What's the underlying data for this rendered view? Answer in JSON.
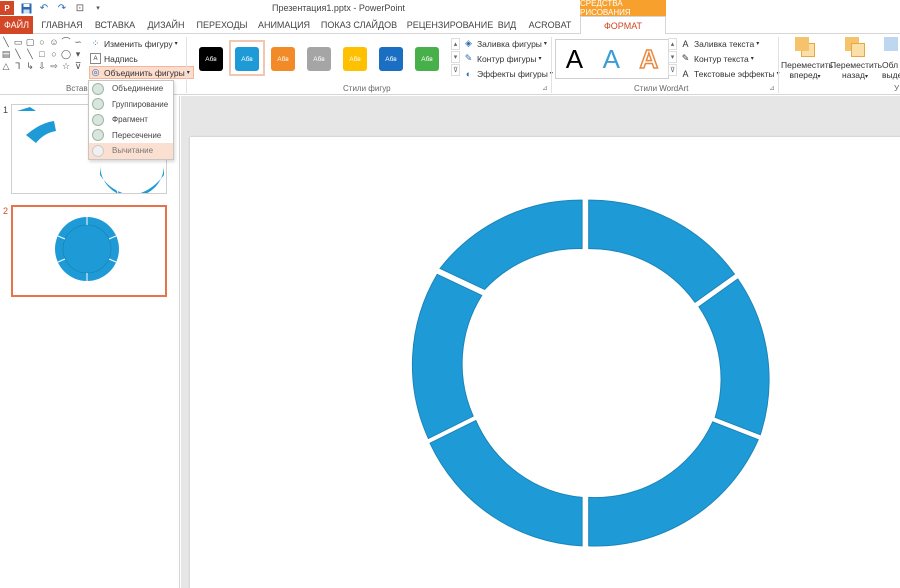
{
  "window": {
    "title": "Презентация1.pptx - PowerPoint",
    "context_title": "СРЕДСТВА РИСОВАНИЯ",
    "app_icon": "P"
  },
  "tabs": [
    {
      "label": "ФАЙЛ"
    },
    {
      "label": "ГЛАВНАЯ"
    },
    {
      "label": "ВСТАВКА"
    },
    {
      "label": "ДИЗАЙН"
    },
    {
      "label": "ПЕРЕХОДЫ"
    },
    {
      "label": "АНИМАЦИЯ"
    },
    {
      "label": "ПОКАЗ СЛАЙДОВ"
    },
    {
      "label": "РЕЦЕНЗИРОВАНИЕ"
    },
    {
      "label": "ВИД"
    },
    {
      "label": "ACROBAT"
    },
    {
      "label": "ФОРМАТ"
    }
  ],
  "ribbon": {
    "insert_group_label": "Вставка",
    "edit_shape": "Изменить фигуру",
    "textbox": "Надпись",
    "merge_shapes": "Объединить фигуры",
    "shape_styles_label": "Стили фигур",
    "swatch_text": "Абв",
    "shape_fill": "Заливка фигуры",
    "shape_outline": "Контур фигуры",
    "shape_effects": "Эффекты фигуры",
    "wordart_label": "Стили WordArt",
    "wordart_letter": "A",
    "text_fill": "Заливка текста",
    "text_outline": "Контур текста",
    "text_effects": "Текстовые эффекты",
    "bring_forward_1": "Переместить",
    "bring_forward_2": "вперед",
    "send_backward_1": "Переместить",
    "send_backward_2": "назад",
    "selection_1": "Обл",
    "selection_2": "выде",
    "arrange_label": "У"
  },
  "swatches": [
    {
      "color": "#000000"
    },
    {
      "color": "#1e9bd7"
    },
    {
      "color": "#f28a28"
    },
    {
      "color": "#a5a5a5"
    },
    {
      "color": "#ffc000"
    },
    {
      "color": "#1a6fc3"
    },
    {
      "color": "#48b04a"
    }
  ],
  "merge_menu": [
    {
      "label": "Объединение"
    },
    {
      "label": "Группирование"
    },
    {
      "label": "Фрагмент"
    },
    {
      "label": "Пересечение"
    },
    {
      "label": "Вычитание"
    }
  ],
  "slides": [
    {
      "number": "1"
    },
    {
      "number": "2"
    }
  ],
  "colors": {
    "accent": "#d24726",
    "ring": "#1e9bd7",
    "ring_stroke": "#1a84b8",
    "context": "#f7a02d"
  }
}
